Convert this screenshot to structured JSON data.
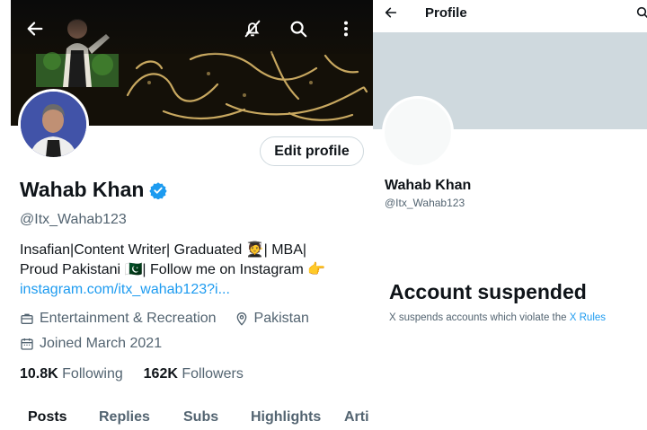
{
  "left_profile": {
    "name": "Wahab Khan",
    "handle": "@Itx_Wahab123",
    "edit_button": "Edit profile",
    "bio_line1": "Insafian|Content Writer| Graduated 🧑‍🎓| MBA|",
    "bio_line2": "Proud Pakistani 🇵🇰| Follow me on Instagram 👉",
    "bio_link": "instagram.com/itx_wahab123?i...",
    "category": "Entertainment & Recreation",
    "location": "Pakistan",
    "joined": "Joined March 2021",
    "following_count": "10.8K",
    "following_label": "Following",
    "followers_count": "162K",
    "followers_label": "Followers",
    "tabs": [
      "Posts",
      "Replies",
      "Subs",
      "Highlights",
      "Arti"
    ],
    "icons": {
      "back": "arrow-left-icon",
      "notifications_off": "bell-slash-icon",
      "search": "search-icon",
      "more": "vertical-ellipsis-icon",
      "verified": "verified-badge-icon",
      "category": "briefcase-icon",
      "location": "location-pin-icon",
      "calendar": "calendar-icon"
    }
  },
  "right_profile": {
    "header_title": "Profile",
    "name": "Wahab Khan",
    "handle": "@Itx_Wahab123",
    "suspended_title": "Account suspended",
    "suspended_note": "X suspends accounts which violate the",
    "rules_link": "X Rules",
    "icons": {
      "back": "arrow-left-icon",
      "search": "search-icon"
    }
  },
  "colors": {
    "accent": "#1d9bf0",
    "text_primary": "#0f1419",
    "text_secondary": "#536471",
    "placeholder_banner": "#cfd9de"
  }
}
